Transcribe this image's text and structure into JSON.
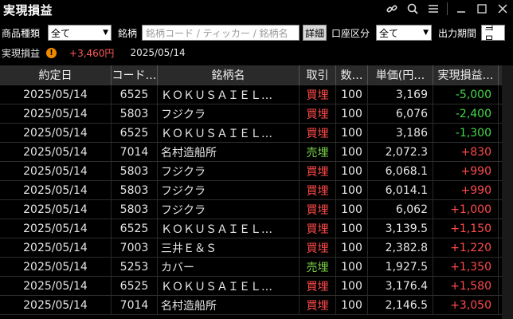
{
  "window": {
    "title": "実現損益"
  },
  "filters": {
    "product_label": "商品種類",
    "product_value": "全て",
    "symbol_label": "銘柄",
    "symbol_placeholder": "銘柄コード / ティッカー / 銘柄名",
    "detail_button": "詳細",
    "account_label": "口座区分",
    "account_value": "全て",
    "period_label": "出力期間",
    "period_value": "当日"
  },
  "summary": {
    "label": "実現損益",
    "total": "+3,460円",
    "date": "2025/05/14"
  },
  "table": {
    "headers": [
      "約定日",
      "コード…",
      "銘柄名",
      "取引",
      "数…",
      "単価(円…",
      "実現損益…"
    ],
    "rows": [
      {
        "date": "2025/05/14",
        "code": "6525",
        "name": "ＫＯＫＵＳＡＩＥＬ…",
        "side": "買埋",
        "side_type": "buy",
        "qty": "100",
        "price": "3,169",
        "pnl": "-5,000",
        "pnl_type": "neg"
      },
      {
        "date": "2025/05/14",
        "code": "5803",
        "name": "フジクラ",
        "side": "買埋",
        "side_type": "buy",
        "qty": "100",
        "price": "6,076",
        "pnl": "-2,400",
        "pnl_type": "neg"
      },
      {
        "date": "2025/05/14",
        "code": "6525",
        "name": "ＫＯＫＵＳＡＩＥＬ…",
        "side": "買埋",
        "side_type": "buy",
        "qty": "100",
        "price": "3,186",
        "pnl": "-1,300",
        "pnl_type": "neg"
      },
      {
        "date": "2025/05/14",
        "code": "7014",
        "name": "名村造船所",
        "side": "売埋",
        "side_type": "sell",
        "qty": "100",
        "price": "2,072.3",
        "pnl": "+830",
        "pnl_type": "pos"
      },
      {
        "date": "2025/05/14",
        "code": "5803",
        "name": "フジクラ",
        "side": "買埋",
        "side_type": "buy",
        "qty": "100",
        "price": "6,068.1",
        "pnl": "+990",
        "pnl_type": "pos"
      },
      {
        "date": "2025/05/14",
        "code": "5803",
        "name": "フジクラ",
        "side": "買埋",
        "side_type": "buy",
        "qty": "100",
        "price": "6,014.1",
        "pnl": "+990",
        "pnl_type": "pos"
      },
      {
        "date": "2025/05/14",
        "code": "5803",
        "name": "フジクラ",
        "side": "買埋",
        "side_type": "buy",
        "qty": "100",
        "price": "6,062",
        "pnl": "+1,000",
        "pnl_type": "pos"
      },
      {
        "date": "2025/05/14",
        "code": "6525",
        "name": "ＫＯＫＵＳＡＩＥＬ…",
        "side": "買埋",
        "side_type": "buy",
        "qty": "100",
        "price": "3,139.5",
        "pnl": "+1,150",
        "pnl_type": "pos"
      },
      {
        "date": "2025/05/14",
        "code": "7003",
        "name": "三井Ｅ＆Ｓ",
        "side": "買埋",
        "side_type": "buy",
        "qty": "100",
        "price": "2,382.8",
        "pnl": "+1,220",
        "pnl_type": "pos"
      },
      {
        "date": "2025/05/14",
        "code": "5253",
        "name": "カバー",
        "side": "売埋",
        "side_type": "sell",
        "qty": "100",
        "price": "1,927.5",
        "pnl": "+1,350",
        "pnl_type": "pos"
      },
      {
        "date": "2025/05/14",
        "code": "6525",
        "name": "ＫＯＫＵＳＡＩＥＬ…",
        "side": "買埋",
        "side_type": "buy",
        "qty": "100",
        "price": "3,176.4",
        "pnl": "+1,580",
        "pnl_type": "pos"
      },
      {
        "date": "2025/05/14",
        "code": "7014",
        "name": "名村造船所",
        "side": "買埋",
        "side_type": "buy",
        "qty": "100",
        "price": "2,146.5",
        "pnl": "+3,050",
        "pnl_type": "pos"
      }
    ]
  },
  "colors": {
    "buy": "#ff4a4a",
    "sell": "#7bd24a",
    "positive": "#ff4a4a",
    "negative": "#43d84a"
  },
  "icons": [
    "link-icon",
    "search-icon",
    "menu-icon",
    "minimize-icon",
    "maximize-icon",
    "close-icon",
    "warning-icon"
  ]
}
